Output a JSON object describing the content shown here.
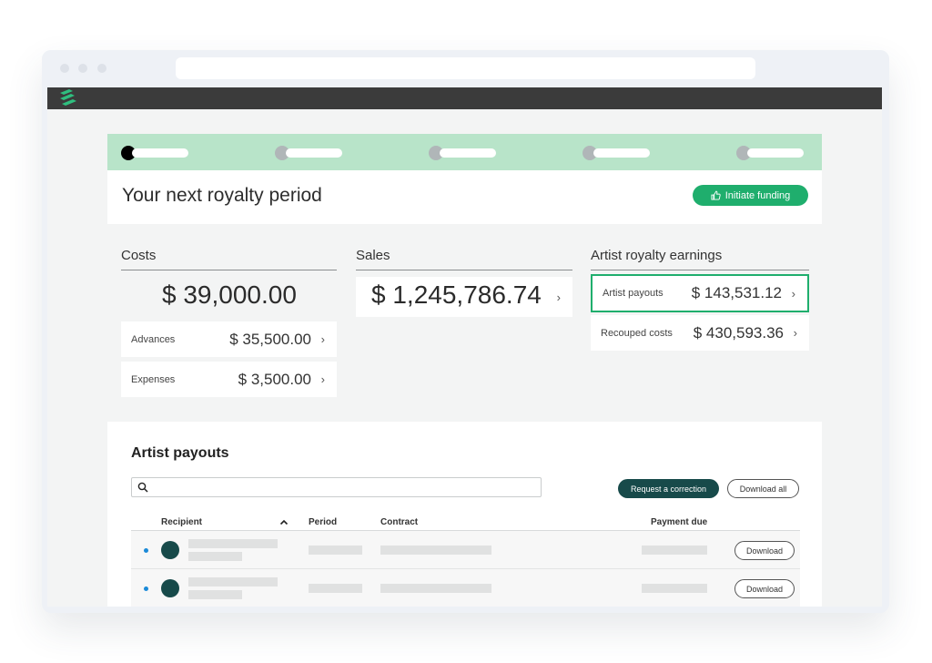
{
  "browser": {
    "url": ""
  },
  "period": {
    "title": "Your next royalty period",
    "initiate_label": "Initiate funding",
    "step_count": 5,
    "active_step": 1
  },
  "costs": {
    "heading": "Costs",
    "total": "$ 39,000.00",
    "items": [
      {
        "label": "Advances",
        "value": "$ 35,500.00"
      },
      {
        "label": "Expenses",
        "value": "$ 3,500.00"
      }
    ]
  },
  "sales": {
    "heading": "Sales",
    "total": "$ 1,245,786.74"
  },
  "earnings": {
    "heading": "Artist royalty earnings",
    "items": [
      {
        "label": "Artist payouts",
        "value": "$ 143,531.12",
        "selected": true
      },
      {
        "label": "Recouped costs",
        "value": "$ 430,593.36",
        "selected": false
      }
    ]
  },
  "payouts": {
    "title": "Artist payouts",
    "search_placeholder": "",
    "request_label": "Request a correction",
    "download_all_label": "Download all",
    "columns": {
      "recipient": "Recipient",
      "period": "Period",
      "contract": "Contract",
      "payment_due": "Payment due"
    },
    "rows": [
      {
        "download_label": "Download"
      },
      {
        "download_label": "Download"
      }
    ]
  },
  "colors": {
    "accent": "#1fae6d",
    "progress_band": "#b8e4c9",
    "dark_teal": "#174a4a",
    "app_bar": "#3b3b3b",
    "status_dot": "#1b8ad8"
  },
  "icons": {
    "logo": "stacked-bars-logo",
    "thumbs_up": "thumbs-up-icon",
    "search": "search-icon",
    "chevron": "chevron-right-icon",
    "sort": "chevron-up-icon"
  }
}
